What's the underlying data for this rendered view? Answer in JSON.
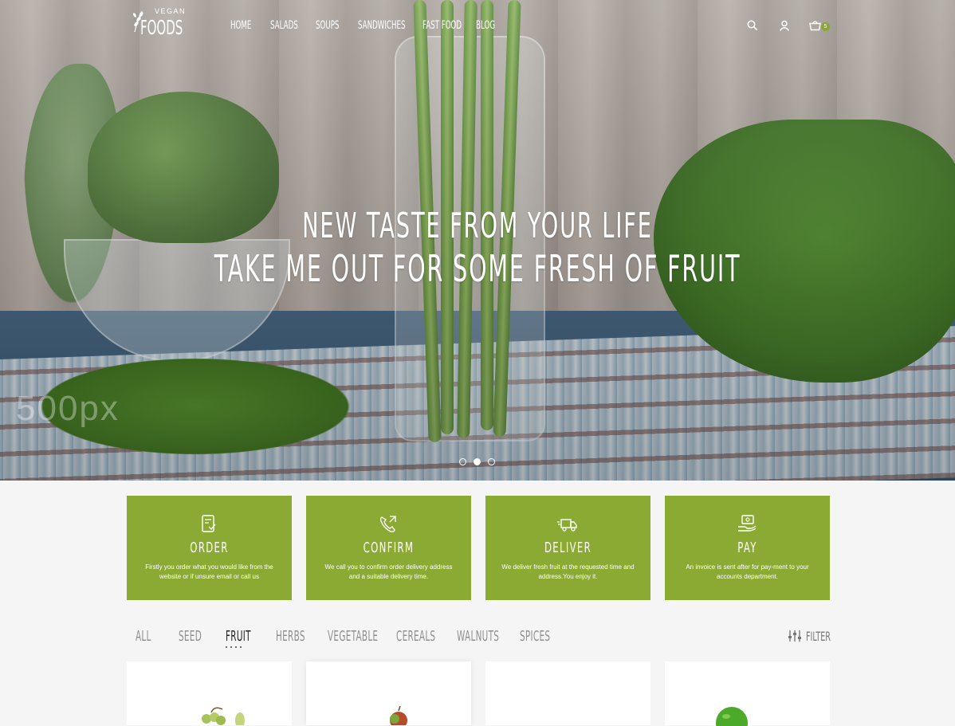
{
  "brand": {
    "top": "VEGAN",
    "name": "FOODS"
  },
  "nav": [
    "HOME",
    "SALADS",
    "SOUPS",
    "SANDWICHES",
    "FAST FOOD",
    "BLOG"
  ],
  "header_icons": [
    "search-icon",
    "user-icon",
    "cart-icon"
  ],
  "cart_count": "5",
  "hero": {
    "line1": "NEW TASTE FROM YOUR LIFE",
    "line2": "TAKE ME OUT FOR SOME FRESH OF FRUIT",
    "watermark": "500px",
    "slides": 3,
    "active_slide": 2
  },
  "steps": [
    {
      "icon": "order-icon",
      "title": "ORDER",
      "desc": "Firstly you order what you would like from the website or if unsure email or call us"
    },
    {
      "icon": "phone-icon",
      "title": "CONFIRM",
      "desc": "We call you to confirm order delivery address and a suitable delivery time."
    },
    {
      "icon": "truck-icon",
      "title": "DELIVER",
      "desc": "We deliver fresh fruit at the requested time and address.You enjoy it."
    },
    {
      "icon": "pay-icon",
      "title": "PAY",
      "desc": "An invoice is sent after for pay-ment to your accounts department."
    }
  ],
  "categories": [
    "ALL",
    "SEED",
    "FRUIT",
    "HERBS",
    "VEGETABLE",
    "CEREALS",
    "WALNUTS",
    "SPICES"
  ],
  "active_category": "FRUIT",
  "filter_label": "FILTER",
  "colors": {
    "accent": "#8aaa33",
    "active_tab": "#222222",
    "inactive_tab": "#8f8f8f"
  }
}
